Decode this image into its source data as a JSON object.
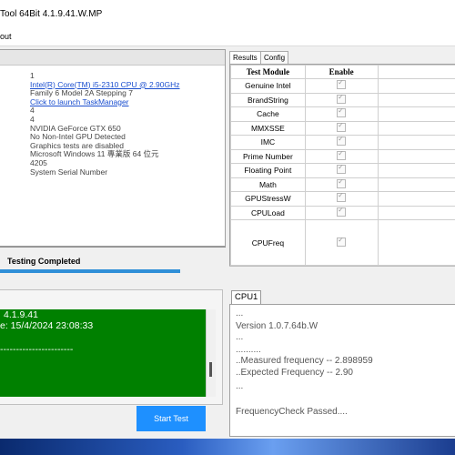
{
  "window": {
    "title": "Tool 64Bit 4.1.9.41.W.MP"
  },
  "menu": {
    "item": "out"
  },
  "system_info": [
    {
      "text": "1",
      "link": false
    },
    {
      "text": "Intel(R) Core(TM) i5-2310 CPU @ 2.90GHz",
      "link": true
    },
    {
      "text": "Family 6 Model 2A Stepping 7",
      "link": false
    },
    {
      "text": "Click to launch TaskManager",
      "link": true
    },
    {
      "text": "4",
      "link": false
    },
    {
      "text": "4",
      "link": false
    },
    {
      "text": "NVIDIA GeForce GTX 650",
      "link": false
    },
    {
      "text": "No  Non-Intel GPU Detected",
      "link": false
    },
    {
      "text": "Graphics tests are disabled",
      "link": false
    },
    {
      "text": "Microsoft Windows 11 專業版 64 位元",
      "link": false
    },
    {
      "text": "4205",
      "link": false
    },
    {
      "text": "System Serial Number",
      "link": false
    }
  ],
  "status": {
    "text": "Testing Completed",
    "progress": 0.99
  },
  "console": {
    "lines": [
      "4.1.9.41",
      "e: 15/4/2024 23:08:33",
      "-----------------------"
    ]
  },
  "buttons": {
    "start": "Start Test"
  },
  "tabs": [
    "Results",
    "Config"
  ],
  "results_table": {
    "headers": [
      "Test Module",
      "Enable"
    ],
    "rows": [
      {
        "name": "Genuine Intel",
        "enabled": true
      },
      {
        "name": "BrandString",
        "enabled": true
      },
      {
        "name": "Cache",
        "enabled": true
      },
      {
        "name": "MMXSSE",
        "enabled": true
      },
      {
        "name": "IMC",
        "enabled": true
      },
      {
        "name": "Prime Number",
        "enabled": true
      },
      {
        "name": "Floating Point",
        "enabled": true
      },
      {
        "name": "Math",
        "enabled": true
      },
      {
        "name": "GPUStressW",
        "enabled": true
      },
      {
        "name": "CPULoad",
        "enabled": true
      },
      {
        "name": "CPUFreq",
        "enabled": true
      }
    ]
  },
  "cpu_tab": {
    "label": "CPU1"
  },
  "cpu_output": [
    "...",
    "Version 1.0.7.64b.W",
    "...",
    "..........",
    "..Measured frequency -- 2.898959",
    "..Expected Frequency -- 2.90",
    "...",
    "",
    "FrequencyCheck Passed...."
  ]
}
